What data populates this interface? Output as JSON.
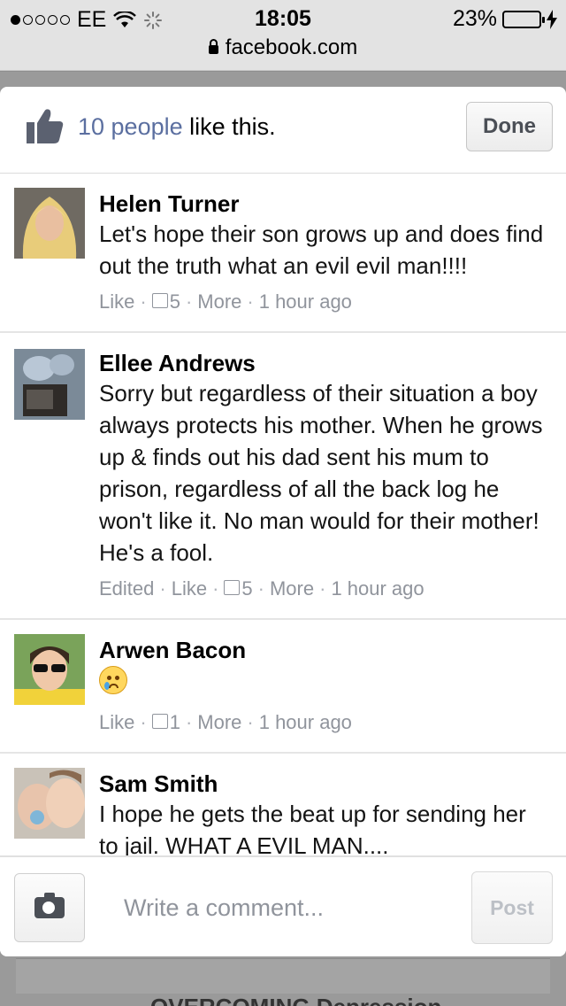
{
  "status_bar": {
    "carrier": "EE",
    "time": "18:05",
    "battery": "23%",
    "battery_level": 0.23,
    "url": "facebook.com"
  },
  "likes_bar": {
    "count_link": "10 people",
    "suffix": " like this.",
    "done_label": "Done"
  },
  "comments": [
    {
      "name": "Helen Turner",
      "text": "Let's hope their son grows up and does find out the truth what an evil evil man!!!!",
      "edited": "",
      "like": "Like",
      "likes": "5",
      "more": "More",
      "time": "1 hour ago"
    },
    {
      "name": "Ellee Andrews",
      "text": "Sorry but regardless of their situation a boy always protects his mother. When he grows up & finds out his dad sent his mum to prison, regardless of all the back log he won't like it. No man would for their mother! He's a fool.",
      "edited": "Edited",
      "like": "Like",
      "likes": "5",
      "more": "More",
      "time": "1 hour ago"
    },
    {
      "name": "Arwen Bacon",
      "text": "",
      "emoji": "crying-face",
      "edited": "",
      "like": "Like",
      "likes": "1",
      "more": "More",
      "time": "1 hour ago"
    },
    {
      "name": "Sam Smith",
      "text": "I hope he gets the beat up for sending her to jail. WHAT A EVIL MAN....",
      "edited": "",
      "like": "",
      "likes": "",
      "more": "",
      "time": ""
    }
  ],
  "composer": {
    "placeholder": "Write a comment...",
    "post_label": "Post"
  },
  "background": {
    "partial_text": "OVERCOMING Depression"
  },
  "colors": {
    "link": "#5b6fa0",
    "meta": "#90949c",
    "battery": "#4cd964"
  }
}
